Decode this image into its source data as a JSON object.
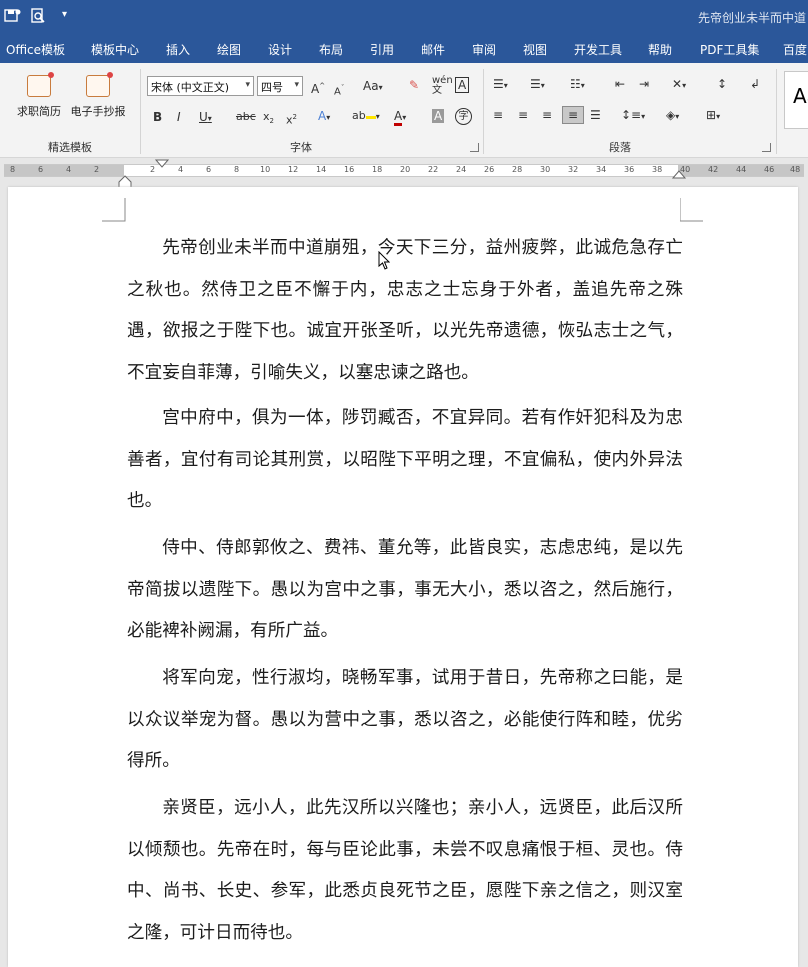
{
  "titlebar": {
    "document_title": "先帝创业未半而中道"
  },
  "tabs": [
    "Office模板",
    "模板中心",
    "插入",
    "绘图",
    "设计",
    "布局",
    "引用",
    "邮件",
    "审阅",
    "视图",
    "开发工具",
    "帮助",
    "PDF工具集",
    "百度"
  ],
  "ribbon": {
    "templates": {
      "resume_label": "求职简历",
      "tabloid_label": "电子手抄报",
      "group_label": "精选模板"
    },
    "font": {
      "font_name": "宋体 (中文正文)",
      "font_size": "四号",
      "group_label": "字体"
    },
    "paragraph": {
      "group_label": "段落"
    },
    "styles_preview": "Aa"
  },
  "ruler": {
    "left_ticks": [
      "8",
      "6",
      "4",
      "2"
    ],
    "right_ticks": [
      "2",
      "4",
      "6",
      "8",
      "10",
      "12",
      "14",
      "16",
      "18",
      "20",
      "22",
      "24",
      "26",
      "28",
      "30",
      "32",
      "34",
      "36",
      "38",
      "40",
      "42",
      "44",
      "46",
      "48"
    ]
  },
  "document": {
    "paragraphs": [
      "先帝创业未半而中道崩殂，今天下三分，益州疲弊，此诚危急存亡之秋也。然侍卫之臣不懈于内，忠志之士忘身于外者，盖追先帝之殊遇，欲报之于陛下也。诚宜开张圣听，以光先帝遗德，恢弘志士之气，不宜妄自菲薄，引喻失义，以塞忠谏之路也。",
      "宫中府中，俱为一体，陟罚臧否，不宜异同。若有作奸犯科及为忠善者，宜付有司论其刑赏，以昭陛下平明之理，不宜偏私，使内外异法也。",
      "侍中、侍郎郭攸之、费祎、董允等，此皆良实，志虑忠纯，是以先帝简拔以遗陛下。愚以为宫中之事，事无大小，悉以咨之，然后施行，必能裨补阙漏，有所广益。",
      "将军向宠，性行淑均，晓畅军事，试用于昔日，先帝称之曰能，是以众议举宠为督。愚以为营中之事，悉以咨之，必能使行阵和睦，优劣得所。",
      "亲贤臣，远小人，此先汉所以兴隆也；亲小人，远贤臣，此后汉所以倾颓也。先帝在时，每与臣论此事，未尝不叹息痛恨于桓、灵也。侍中、尚书、长史、参军，此悉贞良死节之臣，愿陛下亲之信之，则汉室之隆，可计日而待也。"
    ]
  }
}
